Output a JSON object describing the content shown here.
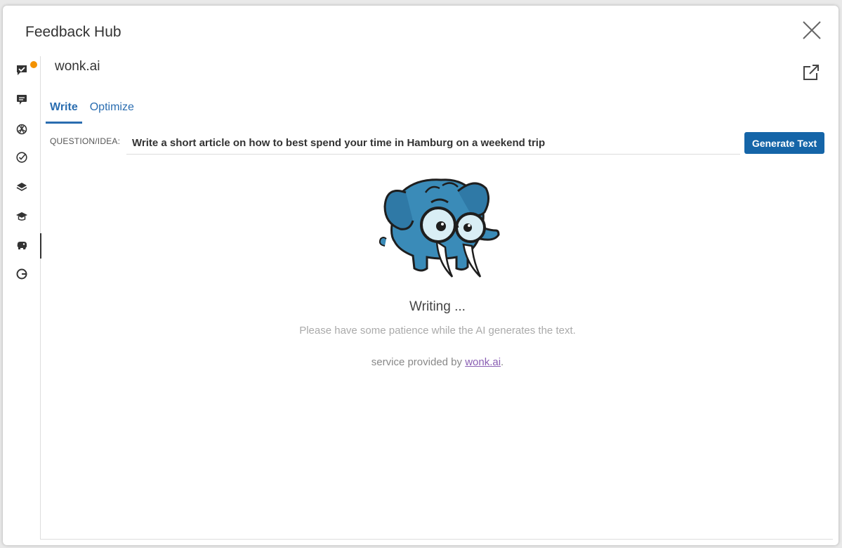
{
  "header": {
    "title": "Feedback Hub"
  },
  "sidebar": {
    "items": [
      {
        "icon": "feedback-check-icon",
        "has_notification": true
      },
      {
        "icon": "chat-bubble-icon"
      },
      {
        "icon": "openai-icon"
      },
      {
        "icon": "check-circle-icon"
      },
      {
        "icon": "layers-icon"
      },
      {
        "icon": "graduation-cap-icon"
      },
      {
        "icon": "mammoth-icon",
        "active": true
      },
      {
        "icon": "grammar-g-icon"
      }
    ],
    "notification_color": "#f39200"
  },
  "app": {
    "name": "wonk.ai"
  },
  "tabs": [
    {
      "label": "Write",
      "active": true
    },
    {
      "label": "Optimize",
      "active": false
    }
  ],
  "form": {
    "question_label": "QUESTION/IDEA:",
    "question_value": "Write a short article on how to best spend your time in Hamburg on a weekend trip",
    "generate_label": "Generate Text"
  },
  "status": {
    "title": "Writing ...",
    "message": "Please have some patience while the AI generates the text.",
    "service_prefix": "service provided by ",
    "service_link": "wonk.ai",
    "service_suffix": "."
  },
  "colors": {
    "accent": "#1565a8",
    "mascot": "#3a8bb8",
    "link": "#8a5fb3"
  }
}
